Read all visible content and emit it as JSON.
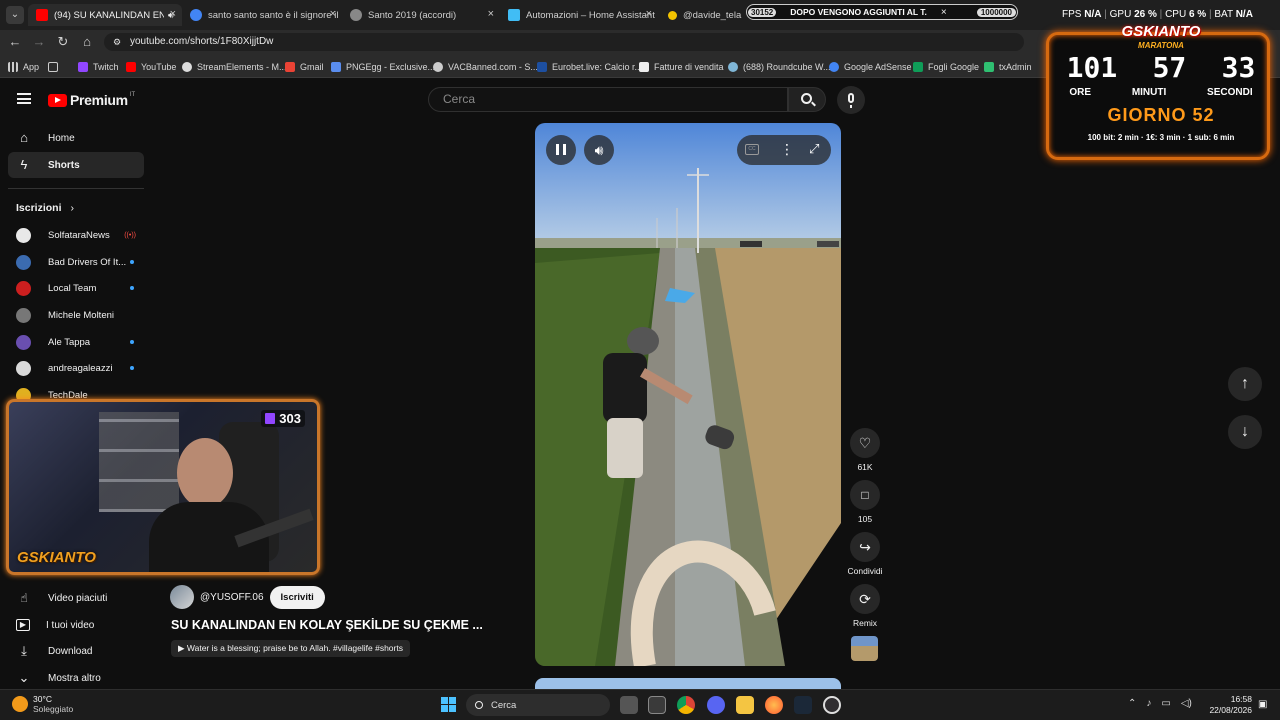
{
  "browser": {
    "tabs": [
      {
        "label": "(94) SU KANALINDAN EN K",
        "color": "#ff0000"
      },
      {
        "label": "santo santo santo è il signore il",
        "color": "#4285f4"
      },
      {
        "label": "Santo 2019 (accordi)",
        "color": "#888888"
      },
      {
        "label": "Automazioni – Home Assistant",
        "color": "#41bdf5"
      },
      {
        "label": "@davide_tela",
        "color": "#9146ff"
      }
    ],
    "tab_close": "×",
    "url": "youtube.com/shorts/1F80XijjtDw",
    "bookmarks": [
      "App",
      "Twitch",
      "YouTube",
      "StreamElements - M...",
      "Gmail",
      "PNGEgg - Exclusive...",
      "VACBanned.com - S...",
      "Eurobet.live: Calcio r...",
      "Fatture di vendita",
      "(688) Roundcube W...",
      "Google AdSense",
      "Fogli Google",
      "txAdmin"
    ]
  },
  "stream_overlay": {
    "ticker_count": "30152",
    "ticker_text": "DOPO VENGONO AGGIUNTI AL T.",
    "ticker_goal": "1000000",
    "stats": {
      "fps_label": "FPS",
      "fps": "N/A",
      "gpu_label": "GPU",
      "gpu": "26 %",
      "cpu_label": "CPU",
      "cpu": "6 %",
      "bat_label": "BAT",
      "bat": "N/A"
    },
    "logo": "GSKIANTO",
    "maratona": "MARATONA",
    "hours": "101",
    "minutes": "57",
    "seconds": "33",
    "hours_label": "ORE",
    "minutes_label": "MINUTI",
    "seconds_label": "SECONDI",
    "day": "GIORNO 52",
    "rules": "100 bit: 2 min · 1€: 3 min · 1 sub: 6 min",
    "viewers": "303",
    "cam_logo": "GSKIANTO"
  },
  "youtube": {
    "logo": "Premium",
    "logo_region": "IT",
    "search_placeholder": "Cerca",
    "nav": [
      {
        "label": "Home",
        "icon": "home-icon",
        "glyph": "⌂"
      },
      {
        "label": "Shorts",
        "icon": "shorts-icon",
        "glyph": "ϟ"
      }
    ],
    "subscriptions_title": "Iscrizioni",
    "subscriptions": [
      {
        "name": "SolfataraNews",
        "color": "#e8e8e8",
        "live": true
      },
      {
        "name": "Bad Drivers Of It...",
        "color": "#3b6bb0",
        "live": false
      },
      {
        "name": "Local Team",
        "color": "#cc1f1f",
        "live": false
      },
      {
        "name": "Michele Molteni",
        "color": "#777777",
        "live": false
      },
      {
        "name": "Ale Tappa",
        "color": "#6a4fb0",
        "live": false
      },
      {
        "name": "andreagaleazzi",
        "color": "#d9d9d9",
        "live": false
      },
      {
        "name": "TechDale",
        "color": "#e0b020",
        "live": false
      }
    ],
    "you_items": [
      {
        "label": "Video piaciuti",
        "glyph": "👍"
      },
      {
        "label": "I tuoi video",
        "glyph": "▶"
      },
      {
        "label": "Download",
        "glyph": "⤓"
      },
      {
        "label": "Mostra altro",
        "glyph": "⌄"
      }
    ],
    "short": {
      "channel": "@YUSOFF.06",
      "subscribe": "Iscriviti",
      "title": "SU KANALINDAN EN KOLAY ŞEKİLDE SU ÇEKME ...",
      "tag": "▶ Water is a blessing; praise be to Allah. #villagelife #shorts",
      "likes": "61K",
      "comments": "105",
      "share": "Condividi",
      "remix": "Remix"
    }
  },
  "taskbar": {
    "weather_temp": "30°C",
    "weather_desc": "Soleggiato",
    "search": "Cerca",
    "time": "16:58",
    "date": "22/08/2026"
  }
}
